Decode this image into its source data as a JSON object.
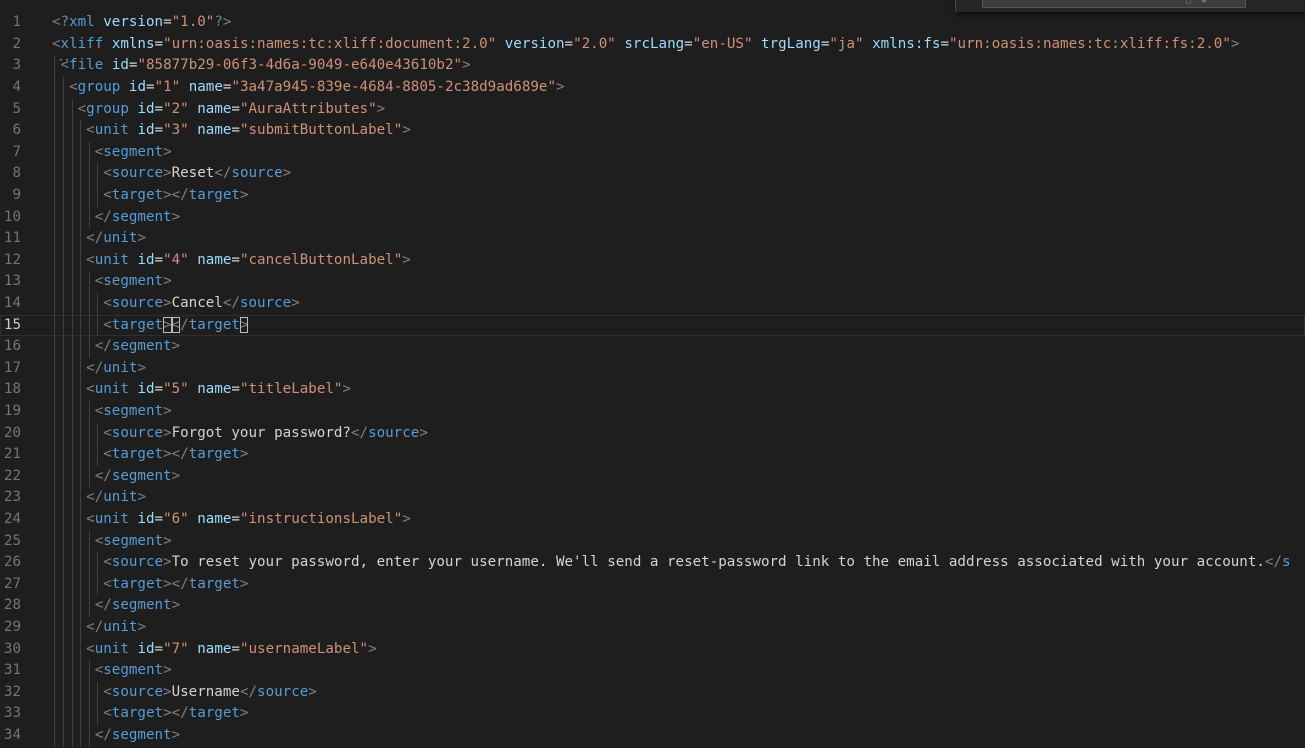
{
  "editor": {
    "current_line": 15,
    "lines": [
      {
        "n": "1",
        "tokens": [
          [
            "br",
            "<?"
          ],
          [
            "tag",
            "xml"
          ],
          [
            "txt",
            " "
          ],
          [
            "attr",
            "version"
          ],
          [
            "txt",
            "="
          ],
          [
            "str",
            "\"1.0\""
          ],
          [
            "br",
            "?>"
          ]
        ]
      },
      {
        "n": "2",
        "tokens": [
          [
            "br",
            "<"
          ],
          [
            "tag",
            "xliff"
          ],
          [
            "txt",
            " "
          ],
          [
            "attr",
            "xmlns"
          ],
          [
            "txt",
            "="
          ],
          [
            "str",
            "\"urn:oasis:names:tc:xliff:document:2.0\""
          ],
          [
            "txt",
            " "
          ],
          [
            "attr",
            "version"
          ],
          [
            "txt",
            "="
          ],
          [
            "str",
            "\"2.0\""
          ],
          [
            "txt",
            " "
          ],
          [
            "attr",
            "srcLang"
          ],
          [
            "txt",
            "="
          ],
          [
            "str",
            "\"en-US\""
          ],
          [
            "txt",
            " "
          ],
          [
            "attr",
            "trgLang"
          ],
          [
            "txt",
            "="
          ],
          [
            "str",
            "\"ja\""
          ],
          [
            "txt",
            " "
          ],
          [
            "attr",
            "xmlns:fs"
          ],
          [
            "txt",
            "="
          ],
          [
            "str",
            "\"urn:oasis:names:tc:xliff:fs:2.0\""
          ],
          [
            "br",
            ">"
          ]
        ]
      },
      {
        "n": "3",
        "tokens": [
          [
            "txt",
            " "
          ],
          [
            "br",
            "<"
          ],
          [
            "tag",
            "file"
          ],
          [
            "txt",
            " "
          ],
          [
            "attr",
            "id"
          ],
          [
            "txt",
            "="
          ],
          [
            "str",
            "\"85877b29-06f3-4d6a-9049-e640e43610b2\""
          ],
          [
            "br",
            ">"
          ]
        ]
      },
      {
        "n": "4",
        "tokens": [
          [
            "txt",
            "  "
          ],
          [
            "br",
            "<"
          ],
          [
            "tag",
            "group"
          ],
          [
            "txt",
            " "
          ],
          [
            "attr",
            "id"
          ],
          [
            "txt",
            "="
          ],
          [
            "str",
            "\"1\""
          ],
          [
            "txt",
            " "
          ],
          [
            "attr",
            "name"
          ],
          [
            "txt",
            "="
          ],
          [
            "str",
            "\"3a47a945-839e-4684-8805-2c38d9ad689e\""
          ],
          [
            "br",
            ">"
          ]
        ]
      },
      {
        "n": "5",
        "tokens": [
          [
            "txt",
            "   "
          ],
          [
            "br",
            "<"
          ],
          [
            "tag",
            "group"
          ],
          [
            "txt",
            " "
          ],
          [
            "attr",
            "id"
          ],
          [
            "txt",
            "="
          ],
          [
            "str",
            "\"2\""
          ],
          [
            "txt",
            " "
          ],
          [
            "attr",
            "name"
          ],
          [
            "txt",
            "="
          ],
          [
            "str",
            "\"AuraAttributes\""
          ],
          [
            "br",
            ">"
          ]
        ]
      },
      {
        "n": "6",
        "tokens": [
          [
            "txt",
            "    "
          ],
          [
            "br",
            "<"
          ],
          [
            "tag",
            "unit"
          ],
          [
            "txt",
            " "
          ],
          [
            "attr",
            "id"
          ],
          [
            "txt",
            "="
          ],
          [
            "str",
            "\"3\""
          ],
          [
            "txt",
            " "
          ],
          [
            "attr",
            "name"
          ],
          [
            "txt",
            "="
          ],
          [
            "str",
            "\"submitButtonLabel\""
          ],
          [
            "br",
            ">"
          ]
        ]
      },
      {
        "n": "7",
        "tokens": [
          [
            "txt",
            "     "
          ],
          [
            "br",
            "<"
          ],
          [
            "tag",
            "segment"
          ],
          [
            "br",
            ">"
          ]
        ]
      },
      {
        "n": "8",
        "tokens": [
          [
            "txt",
            "      "
          ],
          [
            "br",
            "<"
          ],
          [
            "tag",
            "source"
          ],
          [
            "br",
            ">"
          ],
          [
            "txt",
            "Reset"
          ],
          [
            "br",
            "</"
          ],
          [
            "tag",
            "source"
          ],
          [
            "br",
            ">"
          ]
        ]
      },
      {
        "n": "9",
        "tokens": [
          [
            "txt",
            "      "
          ],
          [
            "br",
            "<"
          ],
          [
            "tag",
            "target"
          ],
          [
            "br",
            "></"
          ],
          [
            "tag",
            "target"
          ],
          [
            "br",
            ">"
          ]
        ]
      },
      {
        "n": "10",
        "tokens": [
          [
            "txt",
            "     "
          ],
          [
            "br",
            "</"
          ],
          [
            "tag",
            "segment"
          ],
          [
            "br",
            ">"
          ]
        ]
      },
      {
        "n": "11",
        "tokens": [
          [
            "txt",
            "    "
          ],
          [
            "br",
            "</"
          ],
          [
            "tag",
            "unit"
          ],
          [
            "br",
            ">"
          ]
        ]
      },
      {
        "n": "12",
        "tokens": [
          [
            "txt",
            "    "
          ],
          [
            "br",
            "<"
          ],
          [
            "tag",
            "unit"
          ],
          [
            "txt",
            " "
          ],
          [
            "attr",
            "id"
          ],
          [
            "txt",
            "="
          ],
          [
            "str",
            "\"4\""
          ],
          [
            "txt",
            " "
          ],
          [
            "attr",
            "name"
          ],
          [
            "txt",
            "="
          ],
          [
            "str",
            "\"cancelButtonLabel\""
          ],
          [
            "br",
            ">"
          ]
        ]
      },
      {
        "n": "13",
        "tokens": [
          [
            "txt",
            "     "
          ],
          [
            "br",
            "<"
          ],
          [
            "tag",
            "segment"
          ],
          [
            "br",
            ">"
          ]
        ]
      },
      {
        "n": "14",
        "tokens": [
          [
            "txt",
            "      "
          ],
          [
            "br",
            "<"
          ],
          [
            "tag",
            "source"
          ],
          [
            "br",
            ">"
          ],
          [
            "txt",
            "Cancel"
          ],
          [
            "br",
            "</"
          ],
          [
            "tag",
            "source"
          ],
          [
            "br",
            ">"
          ]
        ]
      },
      {
        "n": "15",
        "tokens": [
          [
            "txt",
            "      "
          ],
          [
            "br",
            "<"
          ],
          [
            "tag",
            "target"
          ],
          [
            "brc",
            ">"
          ],
          [
            "brc",
            "<"
          ],
          [
            "br",
            "/"
          ],
          [
            "tag",
            "target"
          ],
          [
            "brc",
            ">"
          ]
        ]
      },
      {
        "n": "16",
        "tokens": [
          [
            "txt",
            "     "
          ],
          [
            "br",
            "</"
          ],
          [
            "tag",
            "segment"
          ],
          [
            "br",
            ">"
          ]
        ]
      },
      {
        "n": "17",
        "tokens": [
          [
            "txt",
            "    "
          ],
          [
            "br",
            "</"
          ],
          [
            "tag",
            "unit"
          ],
          [
            "br",
            ">"
          ]
        ]
      },
      {
        "n": "18",
        "tokens": [
          [
            "txt",
            "    "
          ],
          [
            "br",
            "<"
          ],
          [
            "tag",
            "unit"
          ],
          [
            "txt",
            " "
          ],
          [
            "attr",
            "id"
          ],
          [
            "txt",
            "="
          ],
          [
            "str",
            "\"5\""
          ],
          [
            "txt",
            " "
          ],
          [
            "attr",
            "name"
          ],
          [
            "txt",
            "="
          ],
          [
            "str",
            "\"titleLabel\""
          ],
          [
            "br",
            ">"
          ]
        ]
      },
      {
        "n": "19",
        "tokens": [
          [
            "txt",
            "     "
          ],
          [
            "br",
            "<"
          ],
          [
            "tag",
            "segment"
          ],
          [
            "br",
            ">"
          ]
        ]
      },
      {
        "n": "20",
        "tokens": [
          [
            "txt",
            "      "
          ],
          [
            "br",
            "<"
          ],
          [
            "tag",
            "source"
          ],
          [
            "br",
            ">"
          ],
          [
            "txt",
            "Forgot your password?"
          ],
          [
            "br",
            "</"
          ],
          [
            "tag",
            "source"
          ],
          [
            "br",
            ">"
          ]
        ]
      },
      {
        "n": "21",
        "tokens": [
          [
            "txt",
            "      "
          ],
          [
            "br",
            "<"
          ],
          [
            "tag",
            "target"
          ],
          [
            "br",
            "></"
          ],
          [
            "tag",
            "target"
          ],
          [
            "br",
            ">"
          ]
        ]
      },
      {
        "n": "22",
        "tokens": [
          [
            "txt",
            "     "
          ],
          [
            "br",
            "</"
          ],
          [
            "tag",
            "segment"
          ],
          [
            "br",
            ">"
          ]
        ]
      },
      {
        "n": "23",
        "tokens": [
          [
            "txt",
            "    "
          ],
          [
            "br",
            "</"
          ],
          [
            "tag",
            "unit"
          ],
          [
            "br",
            ">"
          ]
        ]
      },
      {
        "n": "24",
        "tokens": [
          [
            "txt",
            "    "
          ],
          [
            "br",
            "<"
          ],
          [
            "tag",
            "unit"
          ],
          [
            "txt",
            " "
          ],
          [
            "attr",
            "id"
          ],
          [
            "txt",
            "="
          ],
          [
            "str",
            "\"6\""
          ],
          [
            "txt",
            " "
          ],
          [
            "attr",
            "name"
          ],
          [
            "txt",
            "="
          ],
          [
            "str",
            "\"instructionsLabel\""
          ],
          [
            "br",
            ">"
          ]
        ]
      },
      {
        "n": "25",
        "tokens": [
          [
            "txt",
            "     "
          ],
          [
            "br",
            "<"
          ],
          [
            "tag",
            "segment"
          ],
          [
            "br",
            ">"
          ]
        ]
      },
      {
        "n": "26",
        "tokens": [
          [
            "txt",
            "      "
          ],
          [
            "br",
            "<"
          ],
          [
            "tag",
            "source"
          ],
          [
            "br",
            ">"
          ],
          [
            "txt",
            "To reset your password, enter your username. We'll send a reset-password link to the email address associated with your account."
          ],
          [
            "br",
            "</"
          ],
          [
            "tag",
            "s"
          ]
        ]
      },
      {
        "n": "27",
        "tokens": [
          [
            "txt",
            "      "
          ],
          [
            "br",
            "<"
          ],
          [
            "tag",
            "target"
          ],
          [
            "br",
            "></"
          ],
          [
            "tag",
            "target"
          ],
          [
            "br",
            ">"
          ]
        ]
      },
      {
        "n": "28",
        "tokens": [
          [
            "txt",
            "     "
          ],
          [
            "br",
            "</"
          ],
          [
            "tag",
            "segment"
          ],
          [
            "br",
            ">"
          ]
        ]
      },
      {
        "n": "29",
        "tokens": [
          [
            "txt",
            "    "
          ],
          [
            "br",
            "</"
          ],
          [
            "tag",
            "unit"
          ],
          [
            "br",
            ">"
          ]
        ]
      },
      {
        "n": "30",
        "tokens": [
          [
            "txt",
            "    "
          ],
          [
            "br",
            "<"
          ],
          [
            "tag",
            "unit"
          ],
          [
            "txt",
            " "
          ],
          [
            "attr",
            "id"
          ],
          [
            "txt",
            "="
          ],
          [
            "str",
            "\"7\""
          ],
          [
            "txt",
            " "
          ],
          [
            "attr",
            "name"
          ],
          [
            "txt",
            "="
          ],
          [
            "str",
            "\"usernameLabel\""
          ],
          [
            "br",
            ">"
          ]
        ]
      },
      {
        "n": "31",
        "tokens": [
          [
            "txt",
            "     "
          ],
          [
            "br",
            "<"
          ],
          [
            "tag",
            "segment"
          ],
          [
            "br",
            ">"
          ]
        ]
      },
      {
        "n": "32",
        "tokens": [
          [
            "txt",
            "      "
          ],
          [
            "br",
            "<"
          ],
          [
            "tag",
            "source"
          ],
          [
            "br",
            ">"
          ],
          [
            "txt",
            "Username"
          ],
          [
            "br",
            "</"
          ],
          [
            "tag",
            "source"
          ],
          [
            "br",
            ">"
          ]
        ]
      },
      {
        "n": "33",
        "tokens": [
          [
            "txt",
            "      "
          ],
          [
            "br",
            "<"
          ],
          [
            "tag",
            "target"
          ],
          [
            "br",
            "></"
          ],
          [
            "tag",
            "target"
          ],
          [
            "br",
            ">"
          ]
        ]
      },
      {
        "n": "34",
        "tokens": [
          [
            "txt",
            "     "
          ],
          [
            "br",
            "</"
          ],
          [
            "tag",
            "segment"
          ],
          [
            "br",
            ">"
          ]
        ]
      }
    ]
  },
  "colors": {
    "background": "#1e1e1e",
    "tag": "#569cd6",
    "attribute": "#9cdcfe",
    "string": "#ce9178",
    "text": "#d4d4d4",
    "punctuation": "#808080",
    "line_number": "#6e7681"
  }
}
